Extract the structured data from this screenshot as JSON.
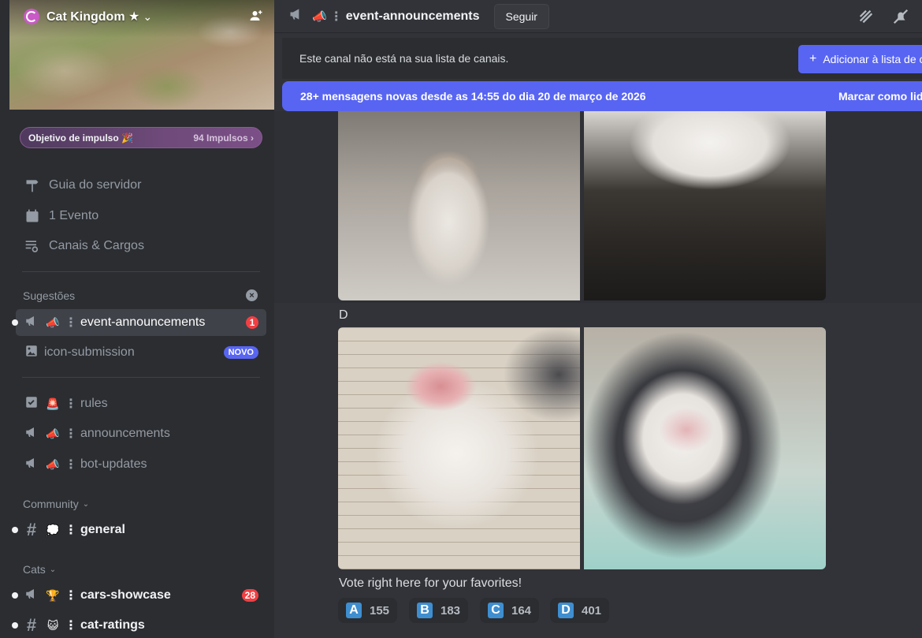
{
  "server": {
    "name": "Cat Kingdom ★",
    "boost": {
      "label": "Objetivo de impulso 🎉",
      "count": "94 Impulsos ›"
    }
  },
  "nav": [
    {
      "label": "Guia do servidor"
    },
    {
      "label": "1 Evento"
    },
    {
      "label": "Canais & Cargos"
    }
  ],
  "sections": {
    "suggestions": "Sugestões",
    "community": "Community",
    "cats": "Cats"
  },
  "channels": {
    "event_announcements": {
      "emoji": "📣",
      "name": "event-announcements",
      "badge": "1"
    },
    "icon_submission": {
      "name": "icon-submission",
      "badge": "NOVO"
    },
    "rules": {
      "emoji": "🚨",
      "name": "rules"
    },
    "announcements": {
      "emoji": "📣",
      "name": "announcements"
    },
    "bot_updates": {
      "emoji": "📣",
      "name": "bot-updates"
    },
    "general": {
      "emoji": "💭",
      "name": "general"
    },
    "cars_showcase": {
      "emoji": "🏆",
      "name": "cars-showcase",
      "badge": "28"
    },
    "cat_ratings": {
      "emoji": "😺",
      "name": "cat-ratings"
    }
  },
  "topbar": {
    "emoji": "📣",
    "channel": "event-announcements",
    "follow": "Seguir"
  },
  "notice": {
    "text": "Este canal não está na sua lista de canais.",
    "button": "Adicionar à lista de canais"
  },
  "newbar": {
    "text": "28+ mensagens novas desde as 14:55 do dia 20 de março de 2026",
    "action": "Marcar como lidas"
  },
  "message": {
    "label_d": "D",
    "vote_text": "Vote right here for your favorites!",
    "reactions": [
      {
        "letter": "A",
        "count": "155"
      },
      {
        "letter": "B",
        "count": "183"
      },
      {
        "letter": "C",
        "count": "164"
      },
      {
        "letter": "D",
        "count": "401"
      }
    ]
  },
  "colors": {
    "accent": "#5865f2",
    "sidebar": "#2b2d31",
    "main": "#313338",
    "danger": "#f23f43"
  }
}
